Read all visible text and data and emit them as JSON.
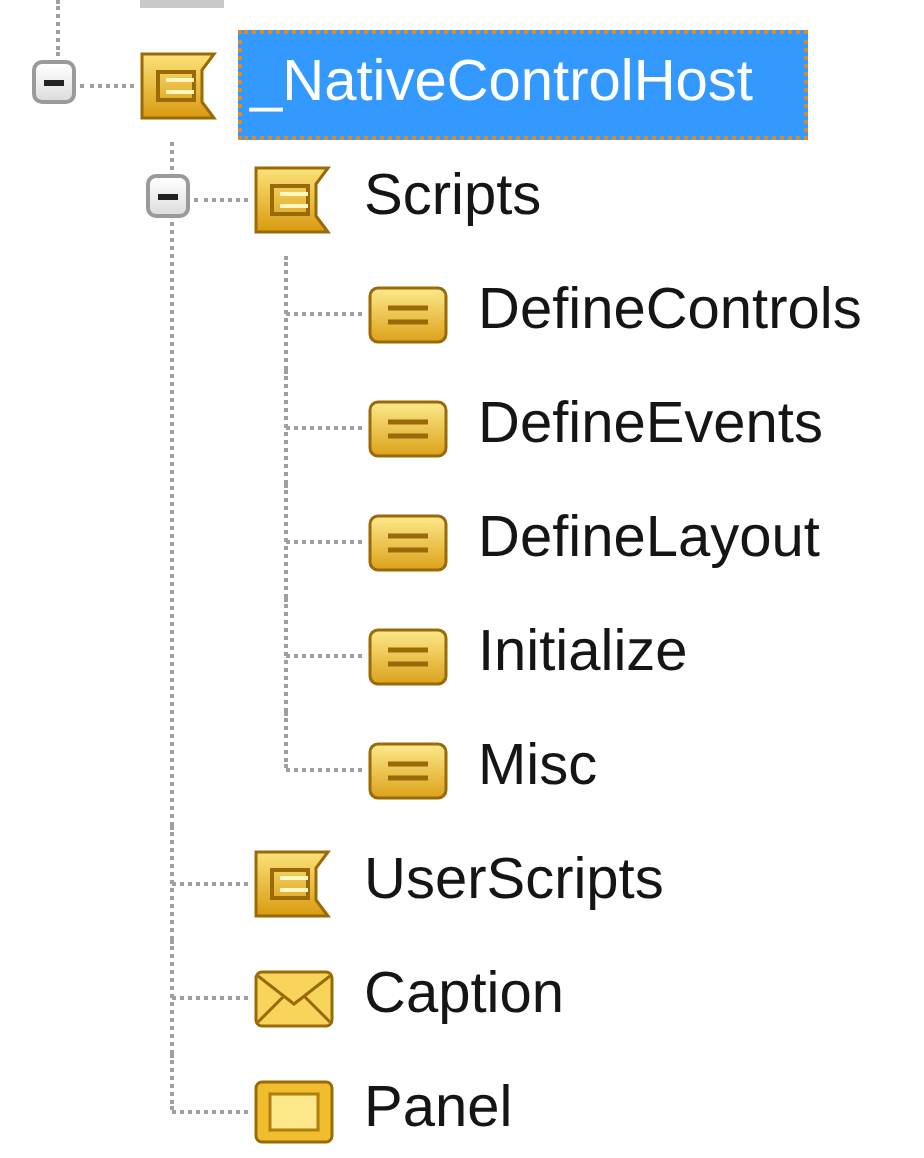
{
  "tree": [
    {
      "label": "_NativeControlHost",
      "kind": "container",
      "expanded": true,
      "selected": true,
      "children": [
        {
          "label": "Scripts",
          "kind": "container",
          "expanded": true,
          "selected": false,
          "children": [
            {
              "label": "DefineControls",
              "kind": "script",
              "selected": false
            },
            {
              "label": "DefineEvents",
              "kind": "script",
              "selected": false
            },
            {
              "label": "DefineLayout",
              "kind": "script",
              "selected": false
            },
            {
              "label": "Initialize",
              "kind": "script",
              "selected": false
            },
            {
              "label": "Misc",
              "kind": "script",
              "selected": false
            }
          ]
        },
        {
          "label": "UserScripts",
          "kind": "container",
          "selected": false
        },
        {
          "label": "Caption",
          "kind": "caption",
          "selected": false
        },
        {
          "label": "Panel",
          "kind": "panel",
          "selected": false
        }
      ]
    }
  ]
}
